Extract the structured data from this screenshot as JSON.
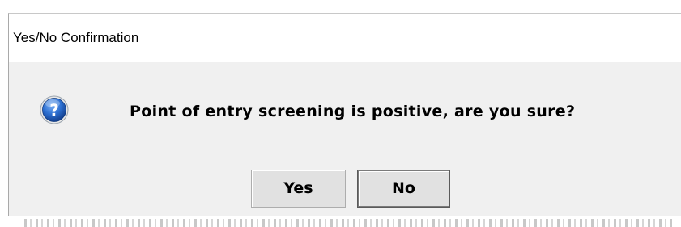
{
  "window": {
    "title": "Yes/No Confirmation"
  },
  "message": {
    "icon": "question-icon",
    "text": "Point of entry screening is positive, are you sure?"
  },
  "buttons": {
    "yes_label": "Yes",
    "no_label": "No"
  },
  "colors": {
    "dialog_background": "#f0f0f0",
    "title_background": "#ffffff",
    "icon_blue": "#1f5fbf",
    "button_face": "#e1e1e1"
  }
}
